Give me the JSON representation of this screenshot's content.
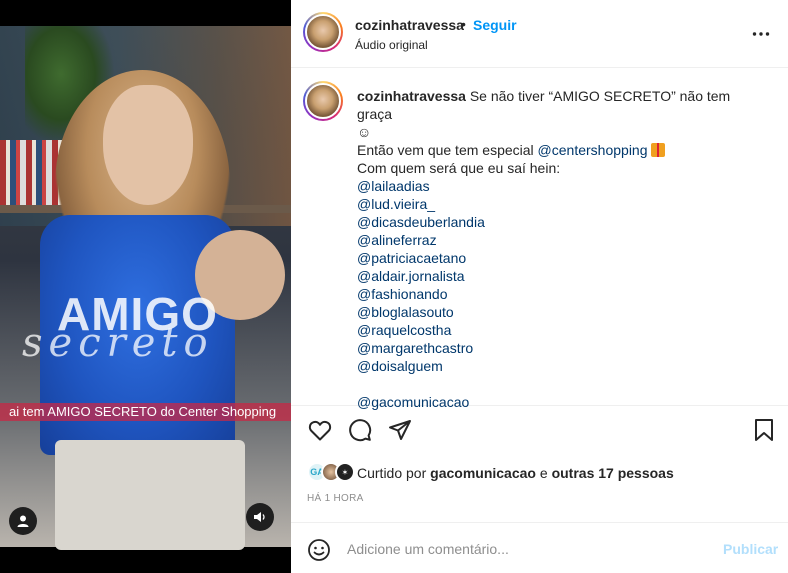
{
  "post": {
    "username": "cozinhatravessa",
    "separator": "•",
    "follow_label": "Seguir",
    "audio_label": "Áudio original",
    "more_icon": "more-horizontal-icon"
  },
  "media": {
    "overlay_title": "AMIGO",
    "overlay_script": "secreto",
    "caption_bar": "ai tem AMIGO SECRETO do Center Shopping",
    "user_icon": "user-icon",
    "sound_icon": "sound-icon"
  },
  "caption": {
    "username": "cozinhatravessa",
    "text_line_1": " Se não tiver “AMIGO SECRETO” não tem graça",
    "text_line_2": "☺",
    "text_line_3": "Então vem que tem especial ",
    "mention_inline": "@centershopping",
    "text_line_4": "Com quem será que eu saí hein:",
    "mentions": [
      "@lailaadias",
      "@lud.vieira_",
      "@dicasdeuberlandia",
      "@alineferraz",
      "@patriciacaetano",
      "@aldair.jornalista",
      "@fashionando",
      "@bloglalasouto",
      "@raquelcostha",
      "@margarethcastro",
      "@doisalguem"
    ],
    "final_mention": "@gacomunicacao"
  },
  "likes": {
    "prefix": "Curtido por ",
    "user": "gacomunicacao",
    "middle": " e ",
    "others": "outras 17 pessoas",
    "mini_avatar_1": "GA",
    "mini_avatar_3": "✶"
  },
  "time": "HÁ 1 HORA",
  "add_comment": {
    "placeholder": "Adicione um comentário...",
    "publish_label": "Publicar"
  },
  "colors": {
    "link_blue": "#0095f6",
    "mention_blue": "#00376b",
    "publish_disabled": "#b2dffc",
    "caption_bar": "#c82846"
  }
}
